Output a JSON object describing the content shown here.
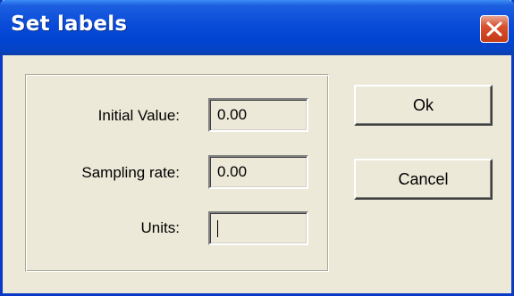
{
  "dialog": {
    "title": "Set labels",
    "close_icon": "close-icon"
  },
  "fields": {
    "initial_value": {
      "label": "Initial Value:",
      "value": "0.00"
    },
    "sampling_rate": {
      "label": "Sampling rate:",
      "value": "0.00"
    },
    "units": {
      "label": "Units:",
      "value": ""
    }
  },
  "buttons": {
    "ok_label": "Ok",
    "cancel_label": "Cancel"
  },
  "colors": {
    "titlebar": "#0a4bd8",
    "window_bg": "#ece9d8",
    "close_button": "#d8512e"
  }
}
